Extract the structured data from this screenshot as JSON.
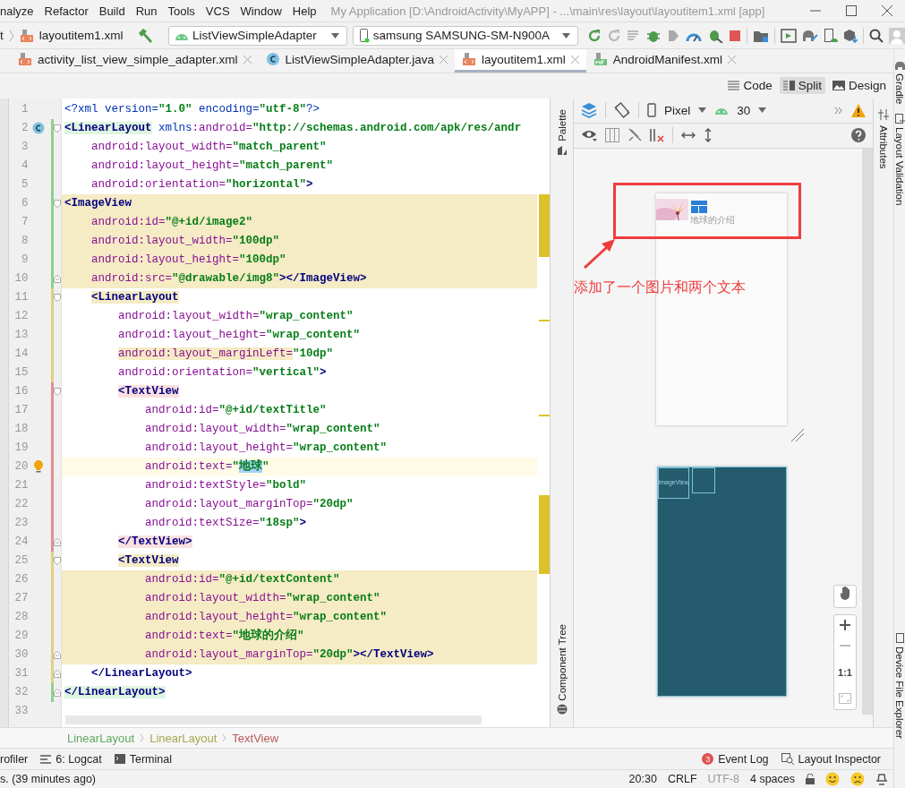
{
  "menu": [
    "nalyze",
    "Refactor",
    "Build",
    "Run",
    "Tools",
    "VCS",
    "Window",
    "Help"
  ],
  "window": {
    "title": "My Application [D:\\AndroidActivity\\MyAPP] - ...\\main\\res\\layout\\layoutitem1.xml [app]"
  },
  "navbar": {
    "crumbs": [
      "t",
      "layoutitem1.xml"
    ],
    "config": "ListViewSimpleAdapter",
    "device": "samsung SAMSUNG-SM-N900A"
  },
  "tabs": [
    {
      "label": "activity_list_view_simple_adapter.xml",
      "kind": "xml",
      "selected": false
    },
    {
      "label": "ListViewSimpleAdapter.java",
      "kind": "class",
      "selected": false
    },
    {
      "label": "layoutitem1.xml",
      "kind": "xml",
      "selected": true
    },
    {
      "label": "AndroidManifest.xml",
      "kind": "manifest",
      "selected": false
    }
  ],
  "view_modes": [
    {
      "label": "Code",
      "kind": "code",
      "selected": false
    },
    {
      "label": "Split",
      "kind": "split",
      "selected": true
    },
    {
      "label": "Design",
      "kind": "design",
      "selected": false
    }
  ],
  "editor": {
    "lines": [
      {
        "number": "1",
        "kind": "plain",
        "highlighted": false,
        "current": false,
        "fold_start": false,
        "fold_end": false,
        "class_icon": false,
        "bulb": false,
        "segs": [
          {
            "kind": "decl",
            "t": "<?xml version="
          },
          {
            "kind": "value",
            "t": "\"1.0\""
          },
          {
            "kind": "decl",
            "t": " encoding="
          },
          {
            "kind": "value",
            "t": "\"utf-8\""
          },
          {
            "kind": "decl",
            "t": "?>"
          }
        ]
      },
      {
        "number": "2",
        "kind": "added",
        "highlighted": false,
        "current": false,
        "fold_start": true,
        "fold_end": false,
        "class_icon": true,
        "bulb": false,
        "segs": [
          {
            "kind": "tag_marked",
            "t": "<LinearLayout"
          },
          {
            "kind": "decl",
            "t": " xmlns"
          },
          {
            "kind": "attr",
            "t": ":android="
          },
          {
            "kind": "value",
            "t": "\"http://schemas.android.com/apk/res/andr"
          }
        ]
      },
      {
        "number": "3",
        "kind": "added",
        "highlighted": false,
        "current": false,
        "fold_start": false,
        "fold_end": false,
        "class_icon": false,
        "bulb": false,
        "segs": [
          {
            "kind": "attr",
            "t": "    android:layout_width="
          },
          {
            "kind": "value",
            "t": "\"match_parent\""
          }
        ]
      },
      {
        "number": "4",
        "kind": "added",
        "highlighted": false,
        "current": false,
        "fold_start": false,
        "fold_end": false,
        "class_icon": false,
        "bulb": false,
        "segs": [
          {
            "kind": "attr",
            "t": "    android:layout_height="
          },
          {
            "kind": "value",
            "t": "\"match_parent\""
          }
        ]
      },
      {
        "number": "5",
        "kind": "added",
        "highlighted": false,
        "current": false,
        "fold_start": false,
        "fold_end": false,
        "class_icon": false,
        "bulb": false,
        "segs": [
          {
            "kind": "attr",
            "t": "    android:orientation="
          },
          {
            "kind": "value",
            "t": "\"horizontal\""
          },
          {
            "kind": "tag",
            "t": ">"
          }
        ]
      },
      {
        "number": "6",
        "kind": "added",
        "highlighted": true,
        "current": false,
        "fold_start": true,
        "fold_end": false,
        "class_icon": false,
        "bulb": false,
        "segs": [
          {
            "kind": "tag",
            "t": "<ImageView"
          }
        ]
      },
      {
        "number": "7",
        "kind": "added",
        "highlighted": true,
        "current": false,
        "fold_start": false,
        "fold_end": false,
        "class_icon": false,
        "bulb": false,
        "segs": [
          {
            "kind": "attr",
            "t": "    android:id="
          },
          {
            "kind": "value",
            "t": "\"@+id/image2\""
          }
        ]
      },
      {
        "number": "8",
        "kind": "added",
        "highlighted": true,
        "current": false,
        "fold_start": false,
        "fold_end": false,
        "class_icon": false,
        "bulb": false,
        "segs": [
          {
            "kind": "attr",
            "t": "    android:layout_width="
          },
          {
            "kind": "value",
            "t": "\"100dp\""
          }
        ]
      },
      {
        "number": "9",
        "kind": "added",
        "highlighted": true,
        "current": false,
        "fold_start": false,
        "fold_end": false,
        "class_icon": false,
        "bulb": false,
        "segs": [
          {
            "kind": "attr",
            "t": "    android:layout_height="
          },
          {
            "kind": "value",
            "t": "\"100dp\""
          }
        ]
      },
      {
        "number": "10",
        "kind": "added",
        "highlighted": true,
        "current": false,
        "fold_start": false,
        "fold_end": true,
        "class_icon": false,
        "bulb": false,
        "segs": [
          {
            "kind": "attr",
            "t": "    android:src="
          },
          {
            "kind": "value",
            "t": "\"@drawable/img8\""
          },
          {
            "kind": "tag",
            "t": "></ImageView>"
          }
        ]
      },
      {
        "number": "11",
        "kind": "modified",
        "highlighted": false,
        "current": false,
        "fold_start": true,
        "fold_end": false,
        "class_icon": false,
        "bulb": false,
        "segs": [
          {
            "kind": "tag_marked",
            "t": "    <LinearLayout"
          }
        ]
      },
      {
        "number": "12",
        "kind": "modified",
        "highlighted": false,
        "current": false,
        "fold_start": false,
        "fold_end": false,
        "class_icon": false,
        "bulb": false,
        "segs": [
          {
            "kind": "attr",
            "t": "        android:layout_width="
          },
          {
            "kind": "value",
            "t": "\"wrap_content\""
          }
        ]
      },
      {
        "number": "13",
        "kind": "modified",
        "highlighted": false,
        "current": false,
        "fold_start": false,
        "fold_end": false,
        "class_icon": false,
        "bulb": false,
        "segs": [
          {
            "kind": "attr",
            "t": "        android:layout_height="
          },
          {
            "kind": "value",
            "t": "\"wrap_content\""
          }
        ]
      },
      {
        "number": "14",
        "kind": "modified",
        "highlighted": false,
        "current": false,
        "fold_start": false,
        "fold_end": false,
        "class_icon": false,
        "bulb": false,
        "segs": [
          {
            "kind": "attr_marked",
            "t": "        android:layout_marginLeft="
          },
          {
            "kind": "value",
            "t": "\"10dp\""
          }
        ]
      },
      {
        "number": "15",
        "kind": "modified",
        "highlighted": false,
        "current": false,
        "fold_start": false,
        "fold_end": false,
        "class_icon": false,
        "bulb": false,
        "segs": [
          {
            "kind": "attr",
            "t": "        android:orientation="
          },
          {
            "kind": "value",
            "t": "\"vertical\""
          },
          {
            "kind": "tag",
            "t": ">"
          }
        ]
      },
      {
        "number": "16",
        "kind": "removed",
        "highlighted": false,
        "current": false,
        "fold_start": true,
        "fold_end": false,
        "class_icon": false,
        "bulb": false,
        "segs": [
          {
            "kind": "tag_marked",
            "t": "        <TextView"
          }
        ]
      },
      {
        "number": "17",
        "kind": "removed",
        "highlighted": false,
        "current": false,
        "fold_start": false,
        "fold_end": false,
        "class_icon": false,
        "bulb": false,
        "segs": [
          {
            "kind": "attr",
            "t": "            android:id="
          },
          {
            "kind": "value",
            "t": "\"@+id/textTitle\""
          }
        ]
      },
      {
        "number": "18",
        "kind": "removed",
        "highlighted": false,
        "current": false,
        "fold_start": false,
        "fold_end": false,
        "class_icon": false,
        "bulb": false,
        "segs": [
          {
            "kind": "attr",
            "t": "            android:layout_width="
          },
          {
            "kind": "value",
            "t": "\"wrap_content\""
          }
        ]
      },
      {
        "number": "19",
        "kind": "removed",
        "highlighted": false,
        "current": false,
        "fold_start": false,
        "fold_end": false,
        "class_icon": false,
        "bulb": false,
        "segs": [
          {
            "kind": "attr",
            "t": "            android:layout_height="
          },
          {
            "kind": "value",
            "t": "\"wrap_content\""
          }
        ]
      },
      {
        "number": "20",
        "kind": "removed",
        "highlighted": false,
        "current": true,
        "fold_start": false,
        "fold_end": false,
        "class_icon": false,
        "bulb": true,
        "segs": [
          {
            "kind": "attr",
            "t": "            android:text="
          },
          {
            "kind": "value",
            "t": "\""
          },
          {
            "kind": "selected",
            "t": "地球"
          },
          {
            "kind": "value",
            "t": "\""
          }
        ]
      },
      {
        "number": "21",
        "kind": "removed",
        "highlighted": false,
        "current": false,
        "fold_start": false,
        "fold_end": false,
        "class_icon": false,
        "bulb": false,
        "segs": [
          {
            "kind": "attr",
            "t": "            android:textStyle="
          },
          {
            "kind": "value",
            "t": "\"bold\""
          }
        ]
      },
      {
        "number": "22",
        "kind": "removed",
        "highlighted": false,
        "current": false,
        "fold_start": false,
        "fold_end": false,
        "class_icon": false,
        "bulb": false,
        "segs": [
          {
            "kind": "attr",
            "t": "            android:layout_marginTop="
          },
          {
            "kind": "value",
            "t": "\"20dp\""
          }
        ]
      },
      {
        "number": "23",
        "kind": "removed",
        "highlighted": false,
        "current": false,
        "fold_start": false,
        "fold_end": false,
        "class_icon": false,
        "bulb": false,
        "segs": [
          {
            "kind": "attr",
            "t": "            android:textSize="
          },
          {
            "kind": "value",
            "t": "\"18sp\""
          },
          {
            "kind": "tag",
            "t": ">"
          }
        ]
      },
      {
        "number": "24",
        "kind": "removed",
        "highlighted": false,
        "current": false,
        "fold_start": false,
        "fold_end": true,
        "class_icon": false,
        "bulb": false,
        "segs": [
          {
            "kind": "tag_marked",
            "t": "        </TextView>"
          }
        ]
      },
      {
        "number": "25",
        "kind": "modified",
        "highlighted": false,
        "current": false,
        "fold_start": true,
        "fold_end": false,
        "class_icon": false,
        "bulb": false,
        "segs": [
          {
            "kind": "tag_marked",
            "t": "        <TextView"
          }
        ]
      },
      {
        "number": "26",
        "kind": "modified",
        "highlighted": true,
        "current": false,
        "fold_start": false,
        "fold_end": false,
        "class_icon": false,
        "bulb": false,
        "segs": [
          {
            "kind": "attr",
            "t": "            android:id="
          },
          {
            "kind": "value",
            "t": "\"@+id/textContent\""
          }
        ]
      },
      {
        "number": "27",
        "kind": "modified",
        "highlighted": true,
        "current": false,
        "fold_start": false,
        "fold_end": false,
        "class_icon": false,
        "bulb": false,
        "segs": [
          {
            "kind": "attr",
            "t": "            android:layout_width="
          },
          {
            "kind": "value",
            "t": "\"wrap_content\""
          }
        ]
      },
      {
        "number": "28",
        "kind": "modified",
        "highlighted": true,
        "current": false,
        "fold_start": false,
        "fold_end": false,
        "class_icon": false,
        "bulb": false,
        "segs": [
          {
            "kind": "attr",
            "t": "            android:layout_height="
          },
          {
            "kind": "value",
            "t": "\"wrap_content\""
          }
        ]
      },
      {
        "number": "29",
        "kind": "modified",
        "highlighted": true,
        "current": false,
        "fold_start": false,
        "fold_end": false,
        "class_icon": false,
        "bulb": false,
        "segs": [
          {
            "kind": "attr",
            "t": "            android:text="
          },
          {
            "kind": "value",
            "t": "\"地球的介绍\""
          }
        ]
      },
      {
        "number": "30",
        "kind": "modified",
        "highlighted": true,
        "current": false,
        "fold_start": false,
        "fold_end": true,
        "class_icon": false,
        "bulb": false,
        "segs": [
          {
            "kind": "attr",
            "t": "            android:layout_marginTop="
          },
          {
            "kind": "value",
            "t": "\"20dp\""
          },
          {
            "kind": "tag",
            "t": "></TextView>"
          }
        ]
      },
      {
        "number": "31",
        "kind": "modified",
        "highlighted": false,
        "current": false,
        "fold_start": false,
        "fold_end": true,
        "class_icon": false,
        "bulb": false,
        "segs": [
          {
            "kind": "tag",
            "t": "    </LinearLayout>"
          }
        ]
      },
      {
        "number": "32",
        "kind": "added",
        "highlighted": false,
        "current": false,
        "fold_start": false,
        "fold_end": true,
        "class_icon": false,
        "bulb": false,
        "segs": [
          {
            "kind": "tag_marked",
            "t": "</LinearLayout>"
          }
        ]
      },
      {
        "number": "33",
        "kind": "plain",
        "highlighted": false,
        "current": false,
        "fold_start": false,
        "fold_end": false,
        "class_icon": false,
        "bulb": false
      }
    ]
  },
  "design": {
    "palette": "Palette",
    "component_tree": "Component Tree",
    "device": "Pixel",
    "api": "30",
    "annotation": "添加了一个图片和两个文本",
    "preview_text": "地球的介绍",
    "blueprint_label": "ImageView",
    "zoom_reset": "1:1"
  },
  "attributes_tab": "Attributes",
  "right_tools": [
    "Gradle",
    "Layout Validation",
    "Device File Explorer"
  ],
  "breadcrumb": [
    {
      "label": "LinearLayout",
      "color": "#62a862"
    },
    {
      "label": "LinearLayout",
      "color": "#a5a84e"
    },
    {
      "label": "TextView",
      "color": "#b85a5a"
    }
  ],
  "tool_windows": {
    "left": [
      "rofiler",
      "6: Logcat",
      "Terminal"
    ],
    "event_log": {
      "label": "Event Log",
      "badge": "3"
    },
    "layout_inspector": "Layout Inspector"
  },
  "status": {
    "message": "s. (39 minutes ago)",
    "items": [
      {
        "label": "20:30",
        "disabled": false
      },
      {
        "label": "CRLF",
        "disabled": false
      },
      {
        "label": "UTF-8",
        "disabled": true
      },
      {
        "label": "4 spaces",
        "disabled": false
      }
    ]
  }
}
